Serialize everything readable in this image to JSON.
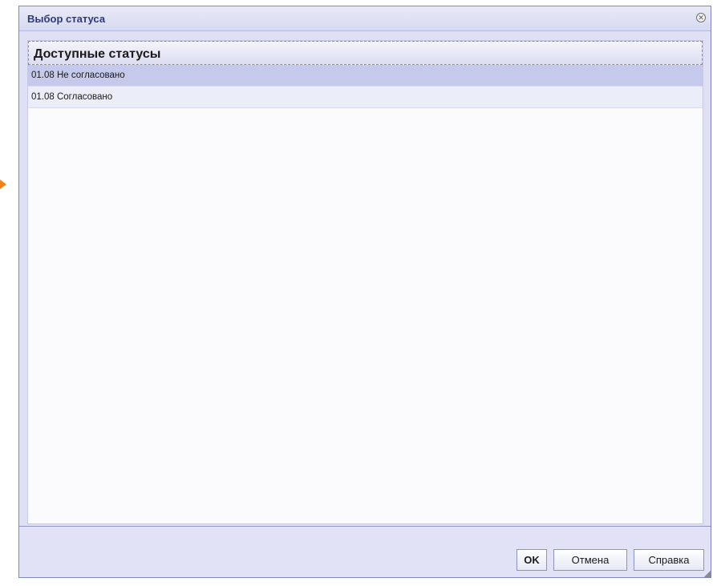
{
  "dialog": {
    "title": "Выбор статуса",
    "close_icon": "close-circle-icon"
  },
  "list": {
    "header": "Доступные статусы",
    "items": [
      {
        "label": "01.08 Не согласовано",
        "selected": true
      },
      {
        "label": "01.08 Согласовано",
        "selected": false
      }
    ]
  },
  "footer": {
    "ok_label": "OK",
    "cancel_label": "Отмена",
    "help_label": "Справка"
  },
  "colors": {
    "accent_arrow": "#f0821e",
    "title_text": "#2c3a78",
    "selected_row": "#c5c9ec"
  }
}
